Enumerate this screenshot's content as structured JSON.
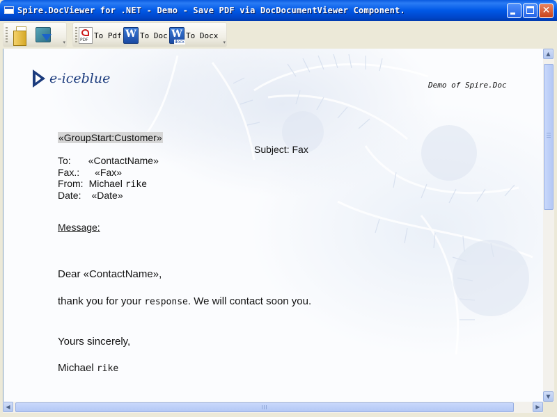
{
  "window": {
    "title": "Spire.DocViewer for .NET - Demo -  Save PDF via DocDocumentViewer Component.",
    "controls": {
      "minimize_icon": "minimize-icon",
      "maximize_icon": "maximize-icon",
      "close_glyph": "✕"
    }
  },
  "toolbar": {
    "open_icon": "open-folder-icon",
    "save_icon": "save-disk-icon",
    "to_pdf_label": "To Pdf",
    "to_doc_label": "To Doc",
    "to_docx_label": "To Docx",
    "pdf_icon_text": "PDF",
    "word_icon_letter": "W",
    "docx_icon_text": "docx",
    "overflow_glyph": "▾"
  },
  "document": {
    "logo_text": "e-iceblue",
    "demo_label": "Demo of Spire.Doc",
    "group_start": "«GroupStart:Customer»",
    "subject": "Subject: Fax",
    "fields": {
      "to_label": "To:",
      "to_value": "«ContactName»",
      "fax_label": "Fax.:",
      "fax_value": "«Fax»",
      "from_label": "From:",
      "from_value_a": "Michael",
      "from_value_b": "rike",
      "date_label": "Date:",
      "date_value": "«Date»"
    },
    "message_label": "Message:",
    "greeting": "Dear «ContactName»,",
    "body_a": "thank you for your ",
    "body_mono": "response",
    "body_b": ". We will contact soon you.",
    "closing": "Yours sincerely,",
    "signature_a": "Michael ",
    "signature_b": "rike"
  },
  "scrollbars": {
    "up_glyph": "▲",
    "down_glyph": "▼",
    "left_glyph": "◀",
    "right_glyph": "▶"
  }
}
